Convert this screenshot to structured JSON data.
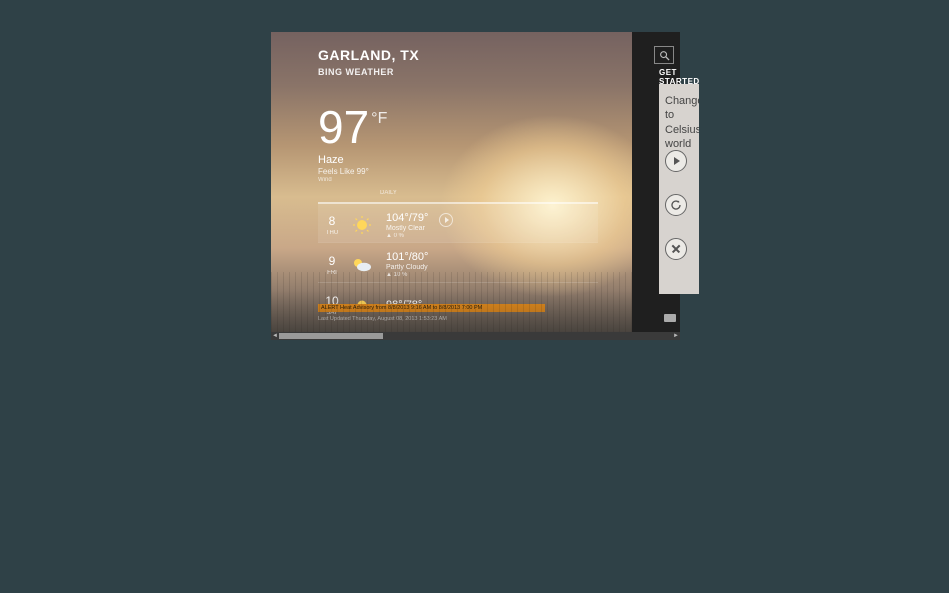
{
  "header": {
    "location": "GARLAND, TX",
    "provider": "BING WEATHER"
  },
  "current": {
    "temp": "97",
    "unit": "°F",
    "condition": "Haze",
    "feels_like": "Feels Like 99°",
    "wind_label": "Wind"
  },
  "forecast": {
    "section_label": "DAILY",
    "days": [
      {
        "date_num": "8",
        "dow": "THU",
        "hilo": "104°/79°",
        "cond": "Mostly Clear",
        "precip": "▲ 0 %",
        "icon": "sun"
      },
      {
        "date_num": "9",
        "dow": "FRI",
        "hilo": "101°/80°",
        "cond": "Partly Cloudy",
        "precip": "▲ 10 %",
        "icon": "partly"
      },
      {
        "date_num": "10",
        "dow": "SAT",
        "hilo": "98°/78°",
        "cond": "",
        "precip": "",
        "icon": "sun"
      }
    ]
  },
  "alert": {
    "text": "ALERT Heat Advisory from 8/8/2013 9:16 AM to 8/8/2013 7:00 PM"
  },
  "footer": {
    "updated": "Last Updated Thursday, August 08, 2013 1:53:23 AM"
  },
  "right": {
    "get_started": "GET STARTED",
    "tip_line1": "Change",
    "tip_line2": "to Celsius",
    "tip_line3": "world"
  },
  "icons": {
    "search": "search",
    "play": "play",
    "refresh": "refresh",
    "close": "close",
    "keyboard": "keyboard"
  },
  "colors": {
    "alert_bg": "#e28a1b",
    "page_bg": "#2f4147"
  }
}
